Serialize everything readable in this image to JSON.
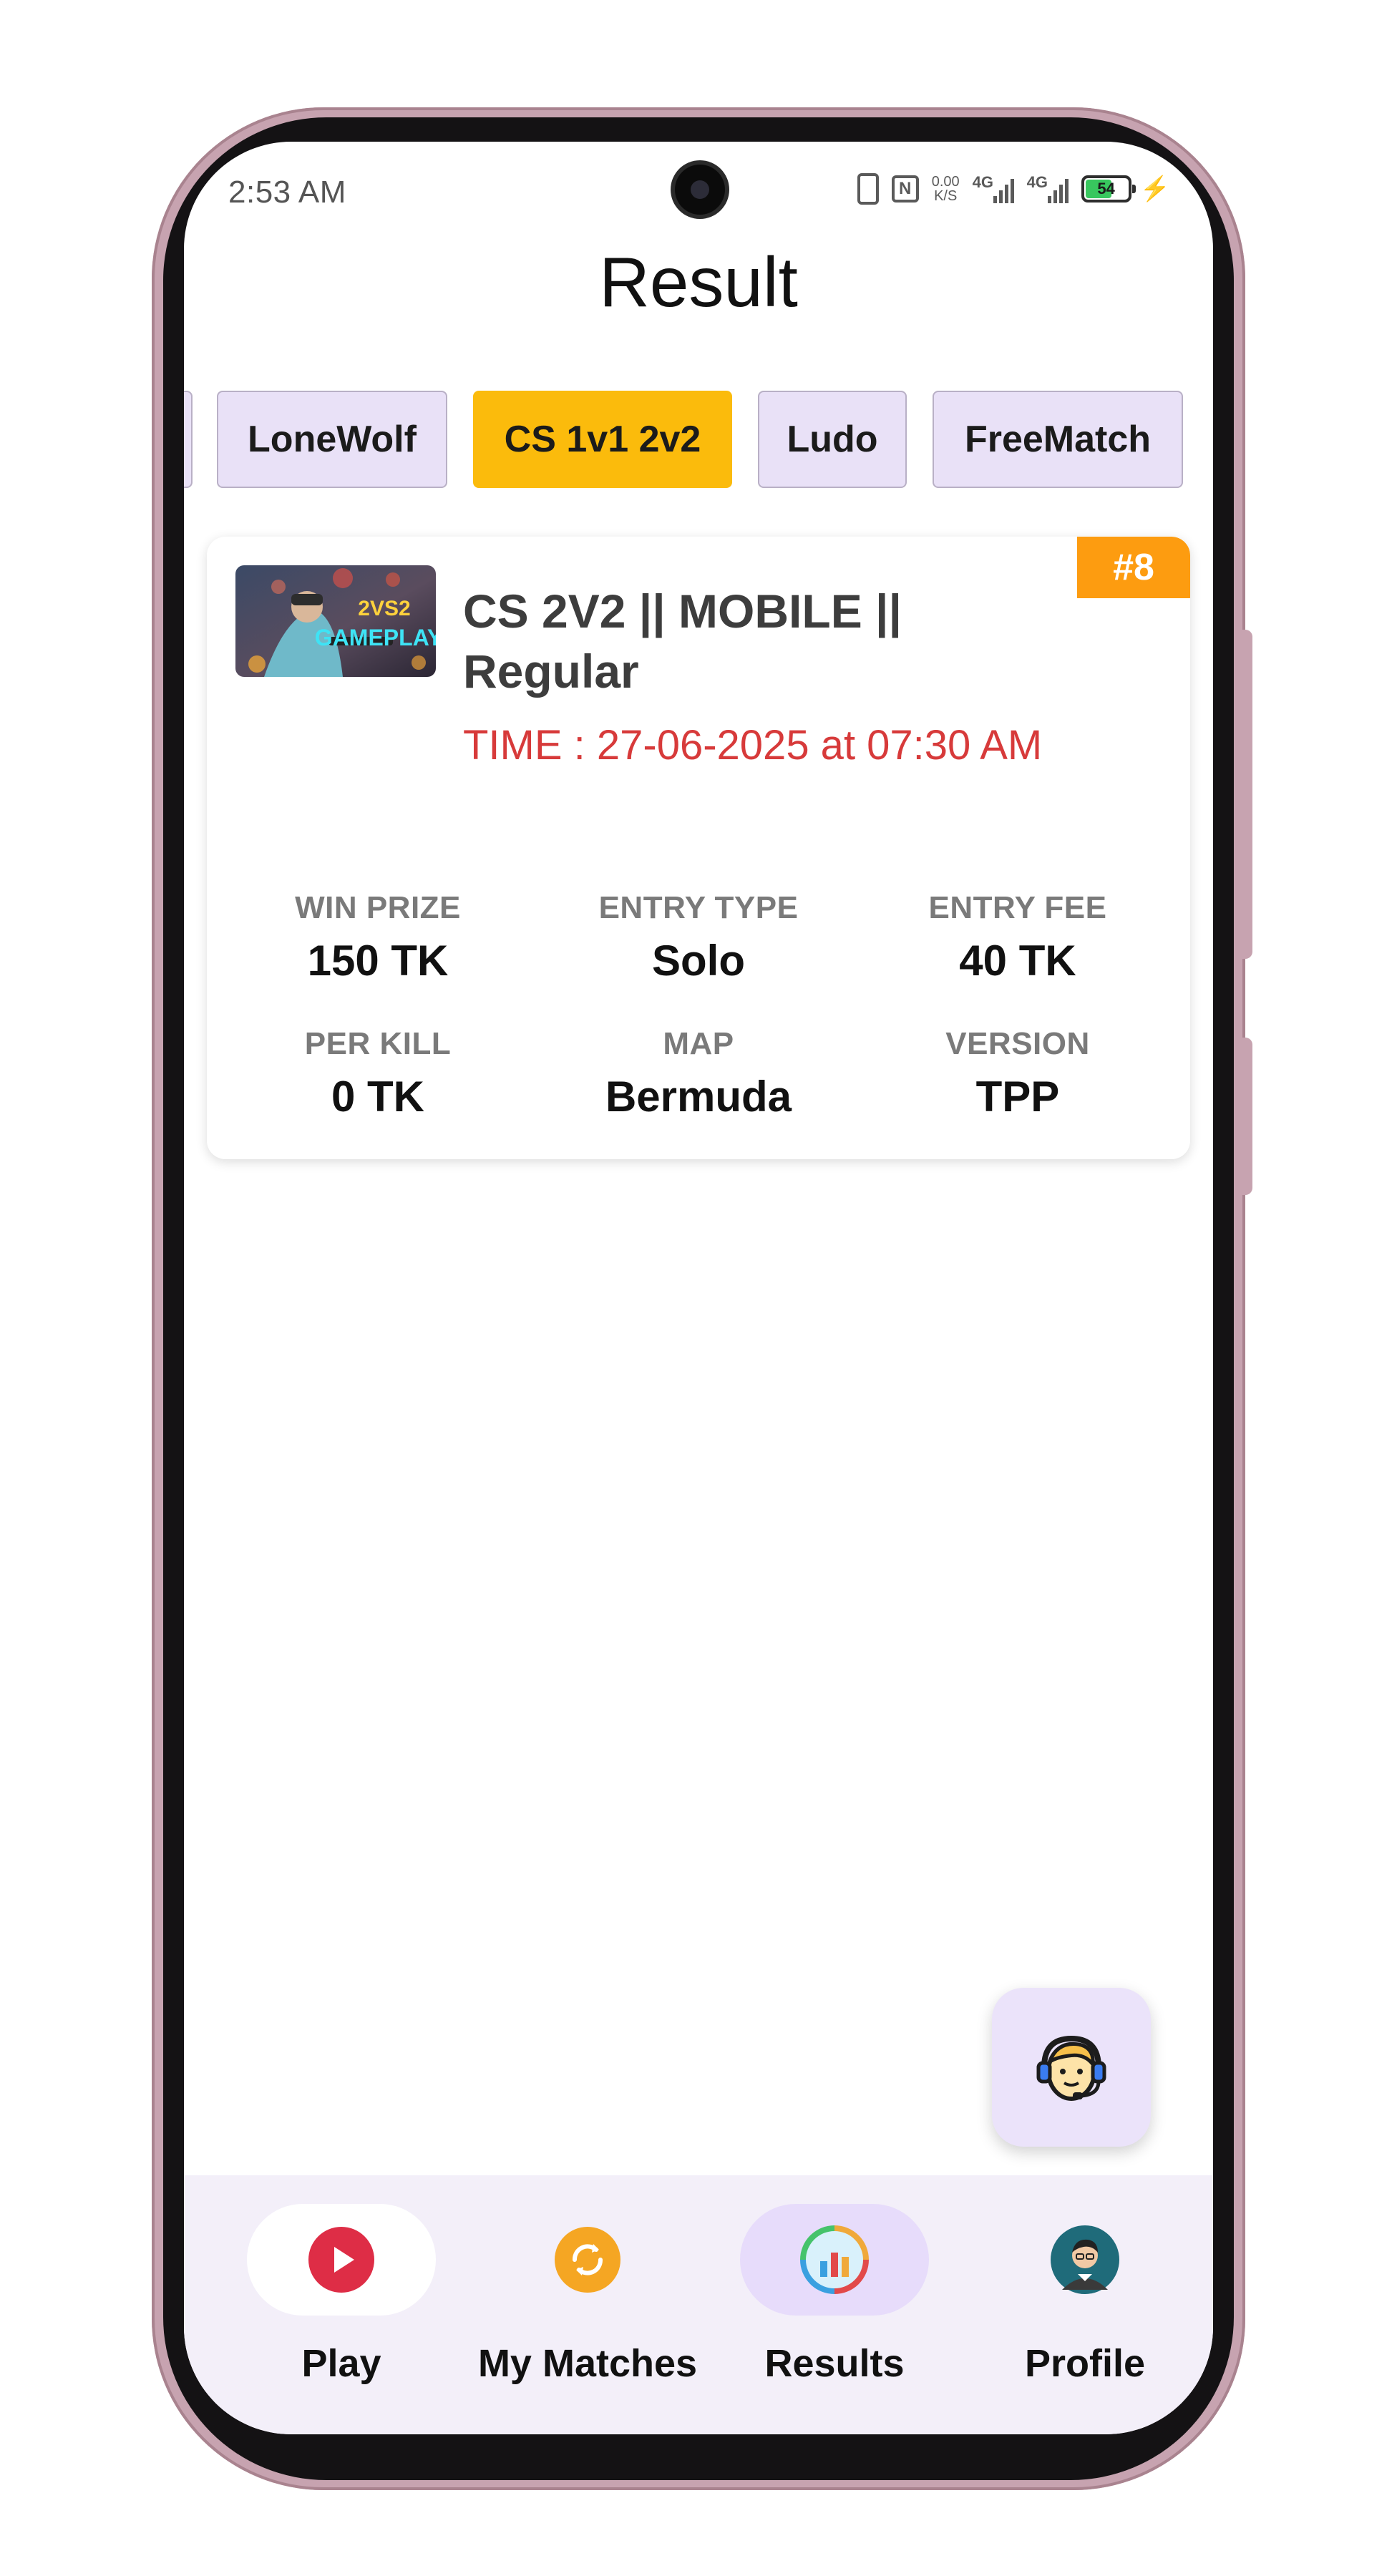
{
  "status_bar": {
    "time": "2:53 AM",
    "speed_value": "0.00",
    "speed_unit": "K/S",
    "network_1": "4G",
    "network_2": "4G",
    "battery": "54"
  },
  "page": {
    "title": "Result"
  },
  "tabs": [
    {
      "label": "LoneWolf",
      "active": false
    },
    {
      "label": "CS 1v1 2v2",
      "active": true
    },
    {
      "label": "Ludo",
      "active": false
    },
    {
      "label": "FreeMatch",
      "active": false
    }
  ],
  "match": {
    "badge": "#8",
    "thumbnail_text_1": "2VS2",
    "thumbnail_text_2": "GAMEPLAY",
    "title": "CS 2V2 || MOBILE || Regular",
    "time": "TIME : 27-06-2025 at 07:30 AM",
    "stats": [
      {
        "label": "WIN PRIZE",
        "value": "150 TK"
      },
      {
        "label": "ENTRY TYPE",
        "value": "Solo"
      },
      {
        "label": "ENTRY FEE",
        "value": "40 TK"
      },
      {
        "label": "PER KILL",
        "value": "0 TK"
      },
      {
        "label": "MAP",
        "value": "Bermuda"
      },
      {
        "label": "VERSION",
        "value": "TPP"
      }
    ]
  },
  "support": {
    "icon": "support-agent-icon"
  },
  "bottom_nav": [
    {
      "label": "Play",
      "icon": "play-icon"
    },
    {
      "label": "My Matches",
      "icon": "refresh-icon"
    },
    {
      "label": "Results",
      "icon": "results-icon",
      "active": true
    },
    {
      "label": "Profile",
      "icon": "profile-avatar-icon"
    }
  ],
  "colors": {
    "accent_tab": "#fbbb0c",
    "tab_bg": "#e9e1f7",
    "badge": "#fd9c10",
    "time_text": "#d73a3a",
    "nav_bg": "#f3eff9"
  }
}
